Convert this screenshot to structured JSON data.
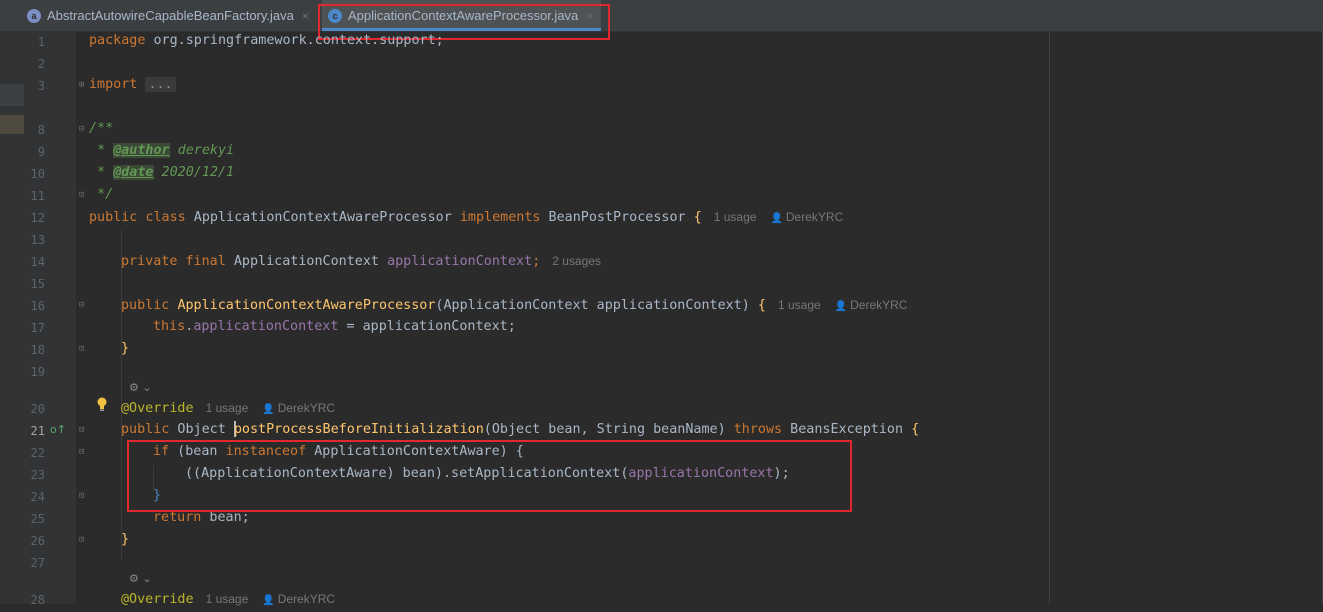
{
  "tabs": [
    {
      "label": "AbstractAutowireCapableBeanFactory.java",
      "icon": "abstract-class-icon",
      "icon_letter": "a"
    },
    {
      "label": "ApplicationContextAwareProcessor.java",
      "icon": "class-icon",
      "icon_letter": "c",
      "active": true
    }
  ],
  "close_glyph": "×",
  "line_numbers": [
    "1",
    "2",
    "3",
    "8",
    "9",
    "10",
    "11",
    "12",
    "13",
    "14",
    "15",
    "16",
    "17",
    "18",
    "19",
    "20",
    "21",
    "22",
    "23",
    "24",
    "25",
    "26",
    "27",
    "28"
  ],
  "code": {
    "package_kw": "package",
    "package_name": " org.springframework.context.support;",
    "import_kw": "import",
    "import_fold": "...",
    "doc_open": "/**",
    "doc_star": " * ",
    "author_tag": "@author",
    "author_val": " derekyi",
    "date_tag": "@date",
    "date_val": " 2020/12/1",
    "doc_close": " */",
    "class_kw": "public class",
    "class_name": " ApplicationContextAwareProcessor ",
    "implements_kw": "implements",
    "iface": " BeanPostProcessor ",
    "brace_open": "{",
    "class_usage": "1 usage",
    "class_author": "DerekYRC",
    "field_kw": "private final",
    "field_type": " ApplicationContext ",
    "field_name": "applicationContext",
    "semi": ";",
    "field_usage": "2 usages",
    "ctor_kw": "public",
    "ctor_name": "ApplicationContextAwareProcessor",
    "ctor_params": "(ApplicationContext applicationContext) ",
    "ctor_usage": "1 usage",
    "ctor_author": "DerekYRC",
    "this_kw": "this",
    "dot": ".",
    "assign": " = applicationContext;",
    "brace_close": "}",
    "override_ann": "@Override",
    "override_usage": "1 usage",
    "override_author": "DerekYRC",
    "method_kw": "public",
    "method_type": " Object ",
    "method_name": "postProcessBeforeInitialization",
    "method_params": "(Object bean, String beanName) ",
    "throws_kw": "throws",
    "exception": " BeansException ",
    "if_kw": "if",
    "if_cond_a": " (bean ",
    "instanceof_kw": "instanceof",
    "if_cond_b": " ApplicationContextAware) {",
    "call_a": "((ApplicationContextAware) bean).setApplicationContext(",
    "call_b": ");",
    "return_kw": "return",
    "return_val": " bean;",
    "override2_ann": "@Override",
    "override2_usage": "1 usage",
    "override2_author": "DerekYRC"
  },
  "colors": {
    "background": "#2b2b2b",
    "keyword": "#cc7832",
    "field": "#9876aa",
    "method": "#ffc66d",
    "annotation": "#bbb529",
    "doc": "#629755",
    "highlight_box": "#e0282e"
  }
}
